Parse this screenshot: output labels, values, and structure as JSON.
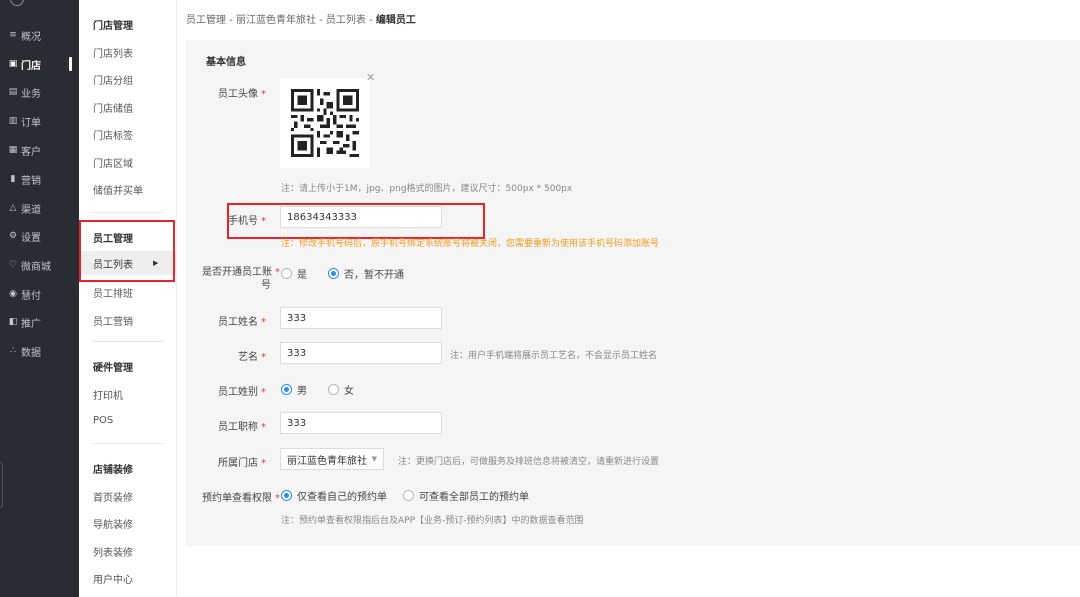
{
  "nav": {
    "items": [
      {
        "icon": "≡",
        "label": "概况"
      },
      {
        "icon": "▣",
        "label": "门店"
      },
      {
        "icon": "▤",
        "label": "业务"
      },
      {
        "icon": "▥",
        "label": "订单"
      },
      {
        "icon": "▦",
        "label": "客户"
      },
      {
        "icon": "▮",
        "label": "营销"
      },
      {
        "icon": "△",
        "label": "渠道"
      },
      {
        "icon": "⚙",
        "label": "设置"
      },
      {
        "icon": "♡",
        "label": "微商城"
      },
      {
        "icon": "◉",
        "label": "慧付"
      },
      {
        "icon": "◧",
        "label": "推广"
      },
      {
        "icon": "∴",
        "label": "数据"
      }
    ]
  },
  "submenu": {
    "store_title": "门店管理",
    "store_items": [
      "门店列表",
      "门店分组",
      "门店储值",
      "门店标签",
      "门店区域",
      "储值并买单"
    ],
    "staff_title": "员工管理",
    "staff_active": "员工列表",
    "staff_items": [
      "员工排班",
      "员工营销"
    ],
    "hw_title": "硬件管理",
    "hw_items": [
      "打印机",
      "POS"
    ],
    "deco_title": "店铺装修",
    "deco_items": [
      "首页装修",
      "导航装修",
      "列表装修",
      "用户中心"
    ]
  },
  "breadcrumb": {
    "path": "员工管理 - 丽江蓝色青年旅社 - 员工列表 - ",
    "current": "编辑员工"
  },
  "form": {
    "section_title": "基本信息",
    "req_mark": "*",
    "avatar_label": "员工头像",
    "avatar_hint": "注：请上传小于1M，jpg、png格式的图片，建议尺寸：500px * 500px",
    "phone_label": "手机号",
    "phone_value": "18634343333",
    "phone_warn": "注：修改手机号码后，原手机号绑定系统账号将被关闭，您需要重新为使用该手机号码添加账号",
    "account_label_1": "是否开通员工账",
    "account_label_2": "号",
    "account_yes": "是",
    "account_no": "否，暂不开通",
    "name_label": "员工姓名",
    "name_value": "333",
    "stage_label": "艺名",
    "stage_value": "333",
    "stage_hint": "注：用户手机端将展示员工艺名，不会显示员工姓名",
    "gender_label": "员工姓别",
    "gender_male": "男",
    "gender_female": "女",
    "title_label": "员工职称",
    "title_value": "333",
    "store_label": "所属门店",
    "store_value": "丽江蓝色青年旅社",
    "store_hint": "注：更换门店后，可做服务及排班信息将被清空，请重新进行设置",
    "perm_label": "预约单查看权限",
    "perm_own": "仅查看自己的预约单",
    "perm_all": "可查看全部员工的预约单",
    "perm_hint": "注：预约单查看权限指后台及APP【业务-预订-预约列表】中的数据查看范围"
  },
  "colors": {
    "nav_bg": "#2a2c33",
    "accent": "#2d8cf0",
    "required": "#e4393c",
    "warn": "#f39b1e",
    "highlight": "#e8242a"
  }
}
